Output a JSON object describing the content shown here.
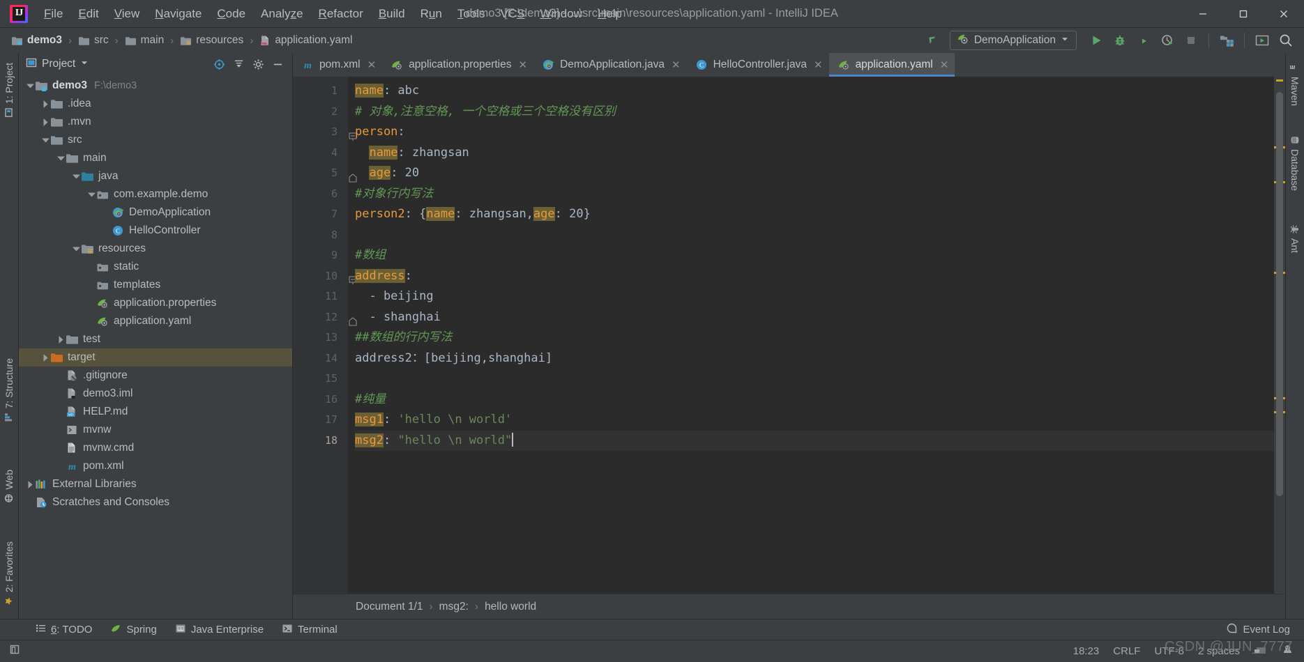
{
  "window": {
    "title": "demo3 [F:\\demo3] - ...\\src\\main\\resources\\application.yaml - IntelliJ IDEA",
    "minimize_label": "Minimize",
    "maximize_label": "Maximize",
    "close_label": "Close"
  },
  "menu": [
    {
      "label": "File",
      "mnemonic": "F"
    },
    {
      "label": "Edit",
      "mnemonic": "E"
    },
    {
      "label": "View",
      "mnemonic": "V"
    },
    {
      "label": "Navigate",
      "mnemonic": "N"
    },
    {
      "label": "Code",
      "mnemonic": "C"
    },
    {
      "label": "Analyze",
      "mnemonic": "z"
    },
    {
      "label": "Refactor",
      "mnemonic": "R"
    },
    {
      "label": "Build",
      "mnemonic": "B"
    },
    {
      "label": "Run",
      "mnemonic": "u"
    },
    {
      "label": "Tools",
      "mnemonic": "T"
    },
    {
      "label": "VCS",
      "mnemonic": "S"
    },
    {
      "label": "Window",
      "mnemonic": "W"
    },
    {
      "label": "Help",
      "mnemonic": "H"
    }
  ],
  "navbar": {
    "crumbs": [
      {
        "label": "demo3",
        "icon": "module-folder-icon"
      },
      {
        "label": "src",
        "icon": "folder-icon"
      },
      {
        "label": "main",
        "icon": "folder-icon"
      },
      {
        "label": "resources",
        "icon": "resources-folder-icon"
      },
      {
        "label": "application.yaml",
        "icon": "yaml-file-icon"
      }
    ],
    "run_config": "DemoApplication",
    "buttons": [
      {
        "name": "update-project-icon",
        "title": "Update Project"
      },
      {
        "name": "run-icon",
        "title": "Run"
      },
      {
        "name": "debug-icon",
        "title": "Debug"
      },
      {
        "name": "run-with-coverage-icon",
        "title": "Run with Coverage"
      },
      {
        "name": "profiler-icon",
        "title": "Profiler"
      },
      {
        "name": "stop-icon",
        "title": "Stop"
      },
      {
        "name": "project-structure-icon",
        "title": "Project Structure"
      },
      {
        "name": "select-opened-file-icon",
        "title": "Select Opened File"
      },
      {
        "name": "search-everywhere-icon",
        "title": "Search Everywhere"
      }
    ]
  },
  "project_panel": {
    "title": "Project",
    "actions": [
      "locate-icon",
      "collapse-all-icon",
      "settings-gear-icon",
      "hide-icon"
    ],
    "tree": [
      {
        "label": "demo3",
        "path": "F:\\demo3",
        "depth": 0,
        "arrow": "down",
        "icon": "module-folder-icon",
        "bold": true
      },
      {
        "label": ".idea",
        "depth": 1,
        "arrow": "right",
        "icon": "folder-icon"
      },
      {
        "label": ".mvn",
        "depth": 1,
        "arrow": "right",
        "icon": "folder-icon"
      },
      {
        "label": "src",
        "depth": 1,
        "arrow": "down",
        "icon": "folder-icon"
      },
      {
        "label": "main",
        "depth": 2,
        "arrow": "down",
        "icon": "folder-icon"
      },
      {
        "label": "java",
        "depth": 3,
        "arrow": "down",
        "icon": "source-folder-icon"
      },
      {
        "label": "com.example.demo",
        "depth": 4,
        "arrow": "down",
        "icon": "package-icon"
      },
      {
        "label": "DemoApplication",
        "depth": 5,
        "arrow": "none",
        "icon": "spring-boot-class-icon"
      },
      {
        "label": "HelloController",
        "depth": 5,
        "arrow": "none",
        "icon": "java-class-icon"
      },
      {
        "label": "resources",
        "depth": 3,
        "arrow": "down",
        "icon": "resources-folder-icon"
      },
      {
        "label": "static",
        "depth": 4,
        "arrow": "none",
        "icon": "package-icon"
      },
      {
        "label": "templates",
        "depth": 4,
        "arrow": "none",
        "icon": "package-icon"
      },
      {
        "label": "application.properties",
        "depth": 4,
        "arrow": "none",
        "icon": "spring-config-icon"
      },
      {
        "label": "application.yaml",
        "depth": 4,
        "arrow": "none",
        "icon": "spring-config-icon"
      },
      {
        "label": "test",
        "depth": 2,
        "arrow": "right",
        "icon": "folder-icon"
      },
      {
        "label": "target",
        "depth": 1,
        "arrow": "right",
        "icon": "excluded-folder-icon",
        "highlighted": true
      },
      {
        "label": ".gitignore",
        "depth": 2,
        "arrow": "none",
        "icon": "gitignore-file-icon"
      },
      {
        "label": "demo3.iml",
        "depth": 2,
        "arrow": "none",
        "icon": "iml-file-icon"
      },
      {
        "label": "HELP.md",
        "depth": 2,
        "arrow": "none",
        "icon": "markdown-file-icon"
      },
      {
        "label": "mvnw",
        "depth": 2,
        "arrow": "none",
        "icon": "script-file-icon"
      },
      {
        "label": "mvnw.cmd",
        "depth": 2,
        "arrow": "none",
        "icon": "cmd-file-icon"
      },
      {
        "label": "pom.xml",
        "depth": 2,
        "arrow": "none",
        "icon": "maven-file-icon"
      },
      {
        "label": "External Libraries",
        "depth": 0,
        "arrow": "right",
        "icon": "libraries-icon"
      },
      {
        "label": "Scratches and Consoles",
        "depth": 0,
        "arrow": "none",
        "icon": "scratches-icon"
      }
    ]
  },
  "left_strip": [
    {
      "label": "1: Project",
      "icon": "project-icon"
    },
    {
      "label": "7: Structure",
      "icon": "structure-icon"
    },
    {
      "label": "Web",
      "icon": "web-icon"
    },
    {
      "label": "2: Favorites",
      "icon": "favorites-icon"
    }
  ],
  "right_strip": [
    {
      "label": "Maven",
      "icon": "maven-icon"
    },
    {
      "label": "Database",
      "icon": "database-icon"
    },
    {
      "label": "Ant",
      "icon": "ant-icon"
    }
  ],
  "editor": {
    "tabs": [
      {
        "label": "pom.xml",
        "icon": "maven-file-icon",
        "active": false
      },
      {
        "label": "application.properties",
        "icon": "spring-config-icon",
        "active": false
      },
      {
        "label": "DemoApplication.java",
        "icon": "spring-boot-class-icon",
        "active": false
      },
      {
        "label": "HelloController.java",
        "icon": "java-class-icon",
        "active": false
      },
      {
        "label": "application.yaml",
        "icon": "spring-config-icon",
        "active": true
      }
    ],
    "lines": [
      {
        "n": "1",
        "fold": "none",
        "tokens": [
          {
            "t": "name",
            "c": "kh"
          },
          {
            "t": ": abc",
            "c": "pl"
          }
        ]
      },
      {
        "n": "2",
        "fold": "none",
        "tokens": [
          {
            "t": "# 对象,注意空格, 一个空格或三个空格没有区别",
            "c": "cm"
          }
        ]
      },
      {
        "n": "3",
        "fold": "open",
        "tokens": [
          {
            "t": "person",
            "c": "k"
          },
          {
            "t": ":",
            "c": "pl"
          }
        ]
      },
      {
        "n": "4",
        "fold": "none",
        "tokens": [
          {
            "t": "  ",
            "c": "pl"
          },
          {
            "t": "name",
            "c": "kh"
          },
          {
            "t": ": zhangsan",
            "c": "pl"
          }
        ]
      },
      {
        "n": "5",
        "fold": "close",
        "tokens": [
          {
            "t": "  ",
            "c": "pl"
          },
          {
            "t": "age",
            "c": "kh"
          },
          {
            "t": ": 20",
            "c": "pl"
          }
        ]
      },
      {
        "n": "6",
        "fold": "none",
        "tokens": [
          {
            "t": "#对象行内写法",
            "c": "cm"
          }
        ]
      },
      {
        "n": "7",
        "fold": "none",
        "tokens": [
          {
            "t": "person2",
            "c": "k"
          },
          {
            "t": ": {",
            "c": "pl"
          },
          {
            "t": "name",
            "c": "kh"
          },
          {
            "t": ": zhangsan,",
            "c": "pl"
          },
          {
            "t": "age",
            "c": "kh"
          },
          {
            "t": ": 20}",
            "c": "pl"
          }
        ]
      },
      {
        "n": "8",
        "fold": "none",
        "tokens": []
      },
      {
        "n": "9",
        "fold": "none",
        "tokens": [
          {
            "t": "#数组",
            "c": "cm"
          }
        ]
      },
      {
        "n": "10",
        "fold": "open",
        "tokens": [
          {
            "t": "address",
            "c": "kh"
          },
          {
            "t": ":",
            "c": "pl"
          }
        ]
      },
      {
        "n": "11",
        "fold": "none",
        "tokens": [
          {
            "t": "  - beijing",
            "c": "pl"
          }
        ]
      },
      {
        "n": "12",
        "fold": "close",
        "tokens": [
          {
            "t": "  - shanghai",
            "c": "pl"
          }
        ]
      },
      {
        "n": "13",
        "fold": "none",
        "tokens": [
          {
            "t": "##数组的行内写法",
            "c": "cm"
          }
        ]
      },
      {
        "n": "14",
        "fold": "none",
        "tokens": [
          {
            "t": "address2：[beijing,shanghai]",
            "c": "pl"
          }
        ]
      },
      {
        "n": "15",
        "fold": "none",
        "tokens": []
      },
      {
        "n": "16",
        "fold": "none",
        "tokens": [
          {
            "t": "#纯量",
            "c": "cm"
          }
        ]
      },
      {
        "n": "17",
        "fold": "none",
        "tokens": [
          {
            "t": "msg1",
            "c": "kh"
          },
          {
            "t": ": ",
            "c": "pl"
          },
          {
            "t": "'hello \\n world'",
            "c": "st"
          }
        ]
      },
      {
        "n": "18",
        "fold": "none",
        "current": true,
        "tokens": [
          {
            "t": "msg2",
            "c": "kh"
          },
          {
            "t": ": ",
            "c": "pl"
          },
          {
            "t": "\"hello \\n world\"",
            "c": "st"
          }
        ]
      }
    ],
    "breadcrumb": [
      "Document 1/1",
      "msg2:",
      "hello  world"
    ]
  },
  "toolwindow_bar": [
    {
      "label": "6: TODO",
      "mnemonic": "6",
      "icon": "todo-icon"
    },
    {
      "label": "Spring",
      "icon": "spring-icon"
    },
    {
      "label": "Java Enterprise",
      "icon": "java-enterprise-icon"
    },
    {
      "label": "Terminal",
      "icon": "terminal-icon"
    }
  ],
  "status_bar": {
    "event_log": "Event Log",
    "time": "18:23",
    "line_separator": "CRLF",
    "encoding": "UTF-8",
    "indent": "2 spaces",
    "watermark": "CSDN @JUN_7777"
  },
  "colors": {
    "accent_blue": "#4a88c7",
    "key_orange": "#e8993a",
    "key_highlight_bg": "#6b6033",
    "comment_green": "#629755",
    "string_green": "#6a8759",
    "panel_bg": "#3c3f41",
    "editor_bg": "#2b2b2b",
    "gutter_bg": "#313335",
    "selection_olive": "#56523c",
    "warning_yellow": "#c9a227"
  }
}
